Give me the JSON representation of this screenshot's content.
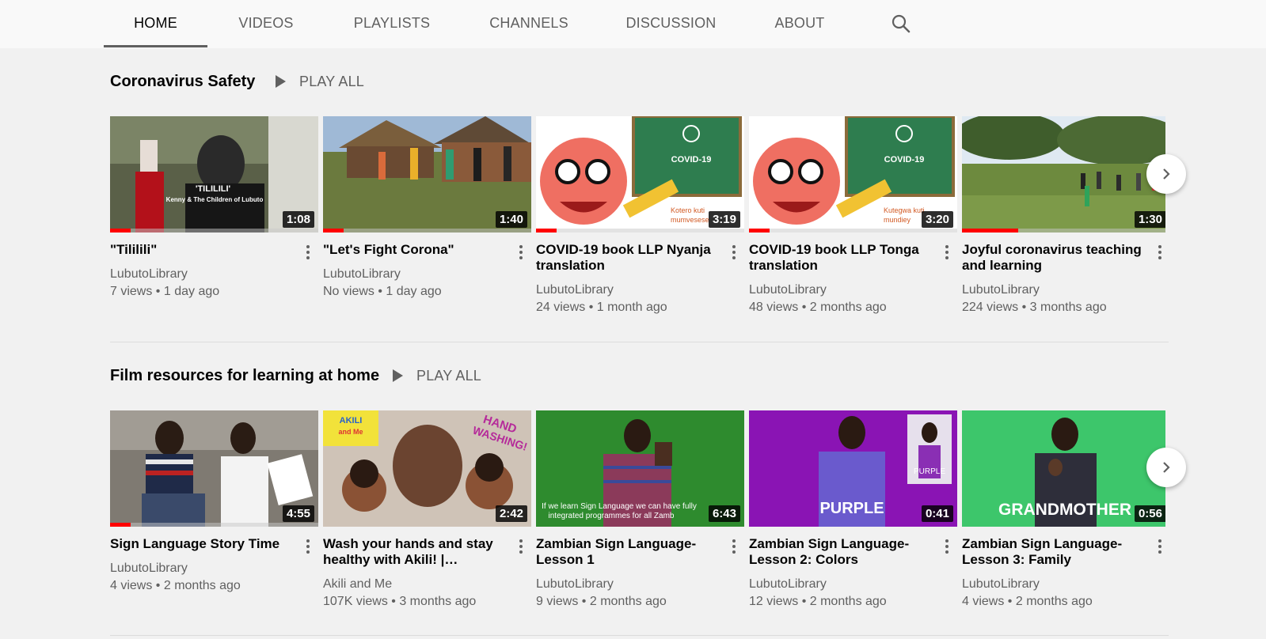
{
  "tabs": [
    {
      "label": "HOME",
      "active": true
    },
    {
      "label": "VIDEOS"
    },
    {
      "label": "PLAYLISTS"
    },
    {
      "label": "CHANNELS"
    },
    {
      "label": "DISCUSSION"
    },
    {
      "label": "ABOUT"
    }
  ],
  "search_icon": "search-icon",
  "colors": {
    "accent": "#ff0000",
    "text": "#030303",
    "secondary": "#606060",
    "background": "#f1f1f1"
  },
  "shelves": [
    {
      "title": "Coronavirus Safety",
      "play_all": "PLAY ALL",
      "videos": [
        {
          "title": "\"Tililili\"",
          "channel": "LubutoLibrary",
          "views": "7 views",
          "age": "1 day ago",
          "duration": "1:08",
          "thumb_text": [
            "'TILILILI'",
            "Kenny & The Children of Lubuto"
          ],
          "watched": 0.1
        },
        {
          "title": "\"Let's Fight Corona\"",
          "channel": "LubutoLibrary",
          "views": "No views",
          "age": "1 day ago",
          "duration": "1:40",
          "watched": 0.1
        },
        {
          "title": "COVID-19 book LLP Nyanja translation",
          "channel": "LubutoLibrary",
          "views": "24 views",
          "age": "1 month ago",
          "duration": "3:19",
          "thumb_text": [
            "COVID-19",
            "Kotero kuti",
            "mumvesese"
          ],
          "watched": 0.1
        },
        {
          "title": "COVID-19 book LLP Tonga translation",
          "channel": "LubutoLibrary",
          "views": "48 views",
          "age": "2 months ago",
          "duration": "3:20",
          "thumb_text": [
            "COVID-19",
            "Kutegwa kuti",
            "mundiey"
          ],
          "watched": 0.1
        },
        {
          "title": "Joyful coronavirus teaching and learning",
          "channel": "LubutoLibrary",
          "views": "224 views",
          "age": "3 months ago",
          "duration": "1:30",
          "watched": 0.27
        }
      ]
    },
    {
      "title": "Film resources for learning at home",
      "play_all": "PLAY ALL",
      "videos": [
        {
          "title": "Sign Language Story Time",
          "channel": "LubutoLibrary",
          "views": "4 views",
          "age": "2 months ago",
          "duration": "4:55",
          "watched": 0.1
        },
        {
          "title": "Wash your hands and stay healthy with Akili! |…",
          "channel": "Akili and Me",
          "views": "107K views",
          "age": "3 months ago",
          "duration": "2:42",
          "thumb_text": [
            "HAND",
            "WASHING!",
            "AKILI",
            "and Me"
          ],
          "watched": 0
        },
        {
          "title": "Zambian Sign Language-Lesson 1",
          "channel": "LubutoLibrary",
          "views": "9 views",
          "age": "2 months ago",
          "duration": "6:43",
          "thumb_text": [
            "If we learn Sign Language we can have fully",
            "integrated programmes for all Zamb"
          ],
          "watched": 0
        },
        {
          "title": "Zambian Sign Language-Lesson 2: Colors",
          "channel": "LubutoLibrary",
          "views": "12 views",
          "age": "2 months ago",
          "duration": "0:41",
          "thumb_text": [
            "PURPLE",
            "PURPLE"
          ],
          "watched": 0
        },
        {
          "title": "Zambian Sign Language-Lesson 3: Family",
          "channel": "LubutoLibrary",
          "views": "4 views",
          "age": "2 months ago",
          "duration": "0:56",
          "thumb_text": [
            "GRANDMOTHER"
          ],
          "watched": 0
        }
      ]
    }
  ]
}
